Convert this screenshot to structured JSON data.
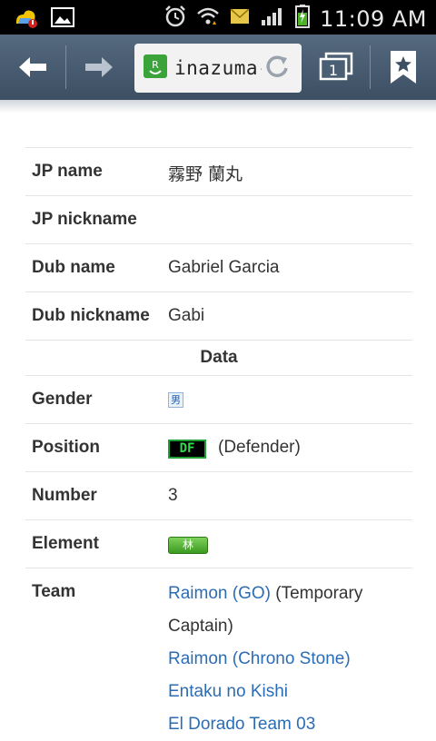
{
  "status_bar": {
    "time": "11:09 AM",
    "icons": [
      "weather-alert-icon",
      "gallery-icon",
      "alarm-icon",
      "wifi-icon",
      "message-icon",
      "signal-icon",
      "battery-charging-icon"
    ]
  },
  "toolbar": {
    "url_text": "inazuma-",
    "tab_count": "1",
    "colors": {
      "toolbar": "#4a5e74",
      "site_icon": "#3aa33a"
    }
  },
  "table": {
    "rows": [
      {
        "label": "JP name",
        "value": "霧野 蘭丸"
      },
      {
        "label": "JP nickname",
        "value": ""
      },
      {
        "label": "Dub name",
        "value": "Gabriel Garcia"
      },
      {
        "label": "Dub nickname",
        "value": "Gabi"
      }
    ],
    "section_header": "Data",
    "gender": {
      "label": "Gender",
      "symbol": "男"
    },
    "position": {
      "label": "Position",
      "badge": "DF",
      "text": "(Defender)"
    },
    "number": {
      "label": "Number",
      "value": "3"
    },
    "element": {
      "label": "Element",
      "badge": "林"
    },
    "team": {
      "label": "Team",
      "link1": "Raimon (GO)",
      "link1_suffix": " (Temporary",
      "link1_suffix2": "Captain)",
      "link2": "Raimon (Chrono Stone)",
      "link3": "Entaku no Kishi",
      "link4": "El Dorado Team 03"
    }
  }
}
